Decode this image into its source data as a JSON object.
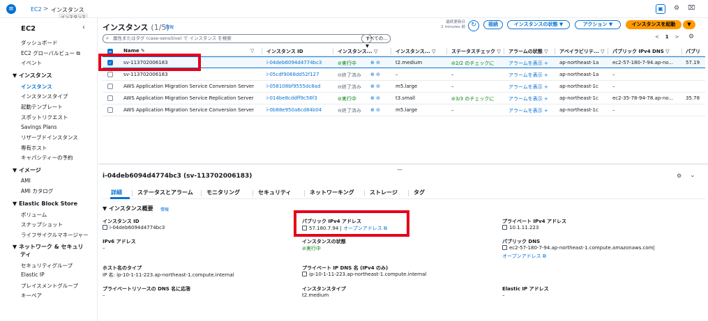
{
  "topbar": {
    "menu_icon": "hamburger-icon",
    "breadcrumb_root": "EC2",
    "breadcrumb_sep": ">",
    "breadcrumb_current": "インスタンス",
    "tooltip": "インスタンス"
  },
  "sidebar": {
    "title": "EC2",
    "items": [
      {
        "label": "ダッシュボード"
      },
      {
        "label": "EC2 グローバルビュー ⧉"
      },
      {
        "label": "イベント"
      }
    ],
    "sec_instances": "▼ インスタンス",
    "instances_items": [
      {
        "label": "インスタンス"
      },
      {
        "label": "インスタンスタイプ"
      },
      {
        "label": "起動テンプレート"
      },
      {
        "label": "スポットリクエスト"
      },
      {
        "label": "Savings Plans"
      },
      {
        "label": "リザーブドインスタンス"
      },
      {
        "label": "専有ホスト"
      },
      {
        "label": "キャパシティーの予約"
      }
    ],
    "sec_images": "▼ イメージ",
    "images_items": [
      {
        "label": "AMI"
      },
      {
        "label": "AMI カタログ"
      }
    ],
    "sec_ebs": "▼ Elastic Block Store",
    "ebs_items": [
      {
        "label": "ボリューム"
      },
      {
        "label": "スナップショット"
      },
      {
        "label": "ライフサイクルマネージャー"
      }
    ],
    "sec_network": "▼ ネットワーク & セキュリ",
    "sec_network2": "ティ",
    "network_items": [
      {
        "label": "セキュリティグループ"
      },
      {
        "label": "Elastic IP"
      },
      {
        "label": "プレイスメントグループ"
      },
      {
        "label": "キーペア"
      }
    ]
  },
  "main": {
    "title": "インスタンス",
    "count": "(1/5)",
    "info": "情報",
    "updated_line1": "最終更新日",
    "updated_line2": "2 minutes 前",
    "btn_connect": "接続",
    "btn_state": "インスタンスの状態 ▼",
    "btn_actions": "アクション ▼",
    "btn_launch": "インスタンスを起動",
    "btn_launch_dd": "▼",
    "search_placeholder": "属性またはタグ (case-sensitive) で インスタンス を検索",
    "filter_value": "すべての... ▼",
    "pager_prev": "<",
    "pager_page": "1",
    "pager_next": ">",
    "columns": {
      "name": "Name ✎",
      "name_sort": "▽",
      "id": "インスタンス ID",
      "state": "インスタンス... ▽",
      "type": "インスタンス... ▽",
      "status": "ステータスチェック ▽",
      "alarm": "アラームの状態 ▽",
      "az": "アベイラビリテ... ▽",
      "dns": "パブリック IPv4 DNS ▽",
      "ip": "パブリ"
    },
    "rows": [
      {
        "name": "sv-113702006183",
        "id": "i-04deb6094d4774bc3",
        "state": "⊘実行中",
        "zoom": "⊕ ⊖",
        "type": "t2.medium",
        "status": "⊘2/2 のチェックに",
        "alarm": "アラームを表示 +",
        "az": "ap-northeast-1a",
        "dns": "ec2-57-180-7-94.ap-no...",
        "ip": "57.19"
      },
      {
        "name": "sv-113702006183",
        "id": "i-05cdf9068dd52f127",
        "state": "⊖終了済み",
        "zoom": "⊕ ⊖",
        "type": "–",
        "status": "–",
        "alarm": "アラームを表示 +",
        "az": "ap-northeast-1a",
        "dns": "–",
        "ip": ""
      },
      {
        "name": "AWS Application Migration Service Conversion Server",
        "id": "i-058108bf9555dc8ad",
        "state": "⊖終了済み",
        "zoom": "⊕ ⊖",
        "type": "m5.large",
        "status": "–",
        "alarm": "アラームを表示 +",
        "az": "ap-northeast-1c",
        "dns": "–",
        "ip": ""
      },
      {
        "name": "AWS Application Migration Service Replication Server",
        "id": "i-014be8cddff9c56f3",
        "state": "⊘実行中",
        "zoom": "⊕ ⊖",
        "type": "t3.small",
        "status": "⊘3/3 のチェックに",
        "alarm": "アラームを表示 +",
        "az": "ap-northeast-1c",
        "dns": "ec2-35-78-94-78.ap-no...",
        "ip": "35.78"
      },
      {
        "name": "AWS Application Migration Service Conversion Server",
        "id": "i-0b88e950a6cd84b04",
        "state": "⊖終了済み",
        "zoom": "⊕ ⊖",
        "type": "m5.large",
        "status": "–",
        "alarm": "アラームを表示 +",
        "az": "ap-northeast-1c",
        "dns": "–",
        "ip": ""
      }
    ]
  },
  "detail": {
    "drag": "—",
    "title": "i-04deb6094d4774bc3 (sv-113702006183)",
    "gear": "⚙",
    "chev": "⌄",
    "tabs": [
      "詳細",
      "ステータスとアラーム",
      "モニタリング",
      "セキュリティ",
      "ネットワーキング",
      "ストレージ",
      "タグ"
    ],
    "summary_heading": "▼ インスタンス概要",
    "summary_info": "情報",
    "fields": {
      "instance_id_label": "インスタンス ID",
      "instance_id_value": "i-04deb6094d4774bc3",
      "public_ip_label": "パブリック IPv4 アドレス",
      "public_ip_value": "57.180.7.94",
      "public_ip_sep": "|",
      "public_ip_link": "オープンアドレス",
      "private_ip_label": "プライベート IPv4 アドレス",
      "private_ip_value": "10.1.11.223",
      "ipv6_label": "IPv6 アドレス",
      "ipv6_value": "–",
      "state_label": "インスタンスの状態",
      "state_value": "⊘実行中",
      "public_dns_label": "パブリック DNS",
      "public_dns_value": "ec2-57-180-7-94.ap-northeast-1.compute.amazonaws.com|",
      "public_dns_link": "オープンアドレス",
      "hostname_label": "ホスト名のタイプ",
      "hostname_value": "IP 名: ip-10-1-11-223.ap-northeast-1.compute.internal",
      "private_dns_label": "プライベート IP DNS 名 (IPv4 のみ)",
      "private_dns_value": "ip-10-1-11-223.ap-northeast-1.compute.internal",
      "resource_dns_label": "プライベートリソースの DNS 名に応答",
      "resource_dns_value": "–",
      "type_label": "インスタンスタイプ",
      "type_value": "t2.medium",
      "eip_label": "Elastic IP アドレス",
      "eip_value": "–"
    }
  },
  "colors": {
    "accent": "#0972d3",
    "primary_button": "#ff9900",
    "running": "#037f0c",
    "highlight_box": "#e6001a"
  }
}
